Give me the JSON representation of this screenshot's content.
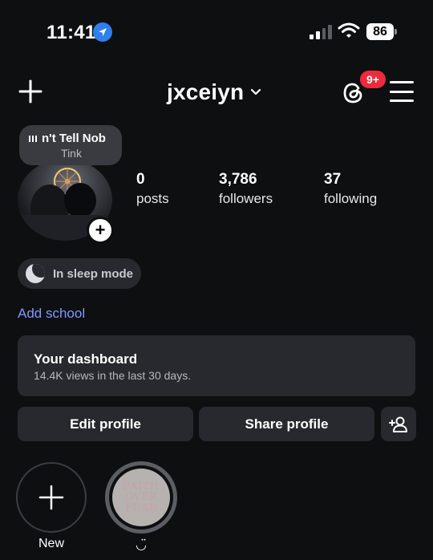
{
  "status_bar": {
    "time": "11:41",
    "battery": "86"
  },
  "header": {
    "username": "jxceiyn",
    "notification_badge": "9+"
  },
  "note": {
    "title": "n't Tell Nob",
    "artist": "Tink"
  },
  "stats": {
    "posts": {
      "value": "0",
      "label": "posts"
    },
    "followers": {
      "value": "3,786",
      "label": "followers"
    },
    "following": {
      "value": "37",
      "label": "following"
    }
  },
  "sleep_mode": {
    "label": "In sleep mode"
  },
  "add_school": "Add school",
  "dashboard": {
    "title": "Your dashboard",
    "subtitle": "14.4K views in the last 30 days."
  },
  "buttons": {
    "edit_profile": "Edit profile",
    "share_profile": "Share profile"
  },
  "highlights": [
    {
      "label": "New"
    },
    {
      "label": "◡̈",
      "cover_text": [
        "FAITH",
        "OVER",
        "FEAR"
      ]
    }
  ],
  "colors": {
    "background": "#0e0f11",
    "card": "#27292e",
    "link": "#7f98ff",
    "badge": "#ee2a3c",
    "location": "#2f80ed"
  }
}
